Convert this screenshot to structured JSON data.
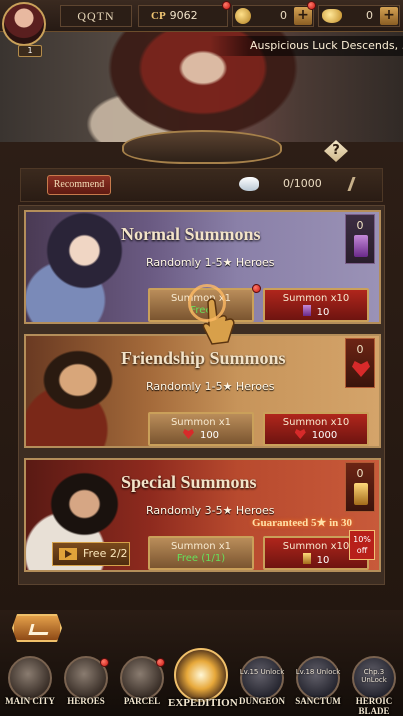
{
  "topbar": {
    "player_name": "QQTN",
    "level": "1",
    "cp_label": "CP",
    "cp_value": "9062",
    "resource1_value": "0",
    "resource2_value": "0",
    "ticker": "Auspicious Luck Descends, ..."
  },
  "panel": {
    "recommend_label": "Recommend",
    "scroll_count": "0/1000",
    "help_label": "?"
  },
  "cards": [
    {
      "title": "Normal Summons",
      "desc": "Randomly 1-5★ Heroes",
      "count": "0",
      "left_btn": {
        "label": "Summon x1",
        "sub": "Free"
      },
      "right_btn": {
        "label": "Summon x10",
        "sub": "10"
      }
    },
    {
      "title": "Friendship Summons",
      "desc": "Randomly 1-5★ Heroes",
      "count": "0",
      "left_btn": {
        "label": "Summon x1",
        "sub": "100"
      },
      "right_btn": {
        "label": "Summon x10",
        "sub": "1000"
      }
    },
    {
      "title": "Special Summons",
      "desc": "Randomly 3-5★ Heroes",
      "count": "0",
      "free_label": "Free 2/2",
      "guaranteed": "Guaranteed 5★ in 30",
      "discount": "10% off",
      "left_btn": {
        "label": "Summon x1",
        "sub": "Free (1/1)"
      },
      "right_btn": {
        "label": "Summon x10",
        "sub": "10"
      }
    }
  ],
  "nav": [
    {
      "label": "MAIN CITY",
      "lock": ""
    },
    {
      "label": "HEROES",
      "lock": ""
    },
    {
      "label": "PARCEL",
      "lock": ""
    },
    {
      "label": "EXPEDITION",
      "lock": ""
    },
    {
      "label": "DUNGEON",
      "lock": "Lv.15 Unlock"
    },
    {
      "label": "SANCTUM",
      "lock": "Lv.18 Unlock"
    },
    {
      "label": "HEROIC BLADE",
      "lock": "Chp.3 UnLock"
    }
  ],
  "colors": {
    "frame_gold": "#b48e5a",
    "free_green": "#66e05a",
    "notif_red": "#c8160f"
  }
}
